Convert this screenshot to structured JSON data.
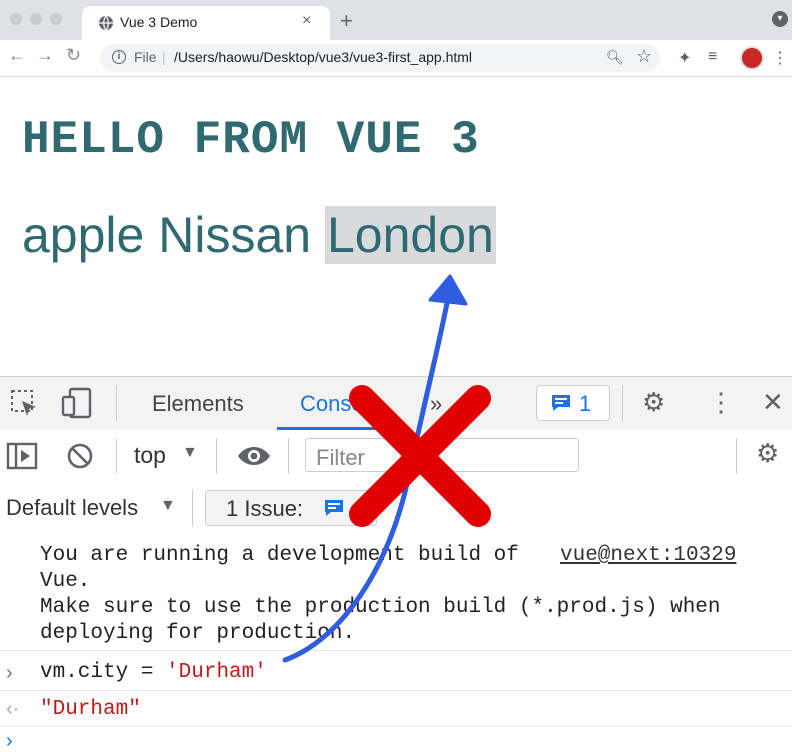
{
  "browser": {
    "tab_title": "Vue 3 Demo",
    "new_tab": "+",
    "close": "×",
    "url_scheme_label": "File",
    "url": "/Users/haowu/Desktop/vue3/vue3-first_app.html"
  },
  "page": {
    "heading": "HELLO FROM VUE 3",
    "words": [
      "apple",
      "Nissan",
      "London"
    ],
    "heading_color": "#2f6a73"
  },
  "devtools": {
    "tabs": [
      "Elements",
      "Console"
    ],
    "active_tab": "Console",
    "more_tabs": "»",
    "issue_count": "1",
    "context": "top",
    "filter_placeholder": "Filter",
    "levels": "Default levels",
    "issues_label": "1 Issue:",
    "console": {
      "message_lines": [
        "You are running a development build of",
        "Vue.",
        "Make sure to use the production build (*.prod.js) when",
        "deploying for production."
      ],
      "message_link": "vue@next:10329",
      "input_cmd": "vm.city = 'Durham'",
      "input_cmd_prefix": "vm.city = ",
      "input_cmd_value": "'Durham'",
      "output": "\"Durham\""
    }
  },
  "annotations": {
    "cross_color": "#e00000",
    "arrow_color": "#2f5de0"
  }
}
